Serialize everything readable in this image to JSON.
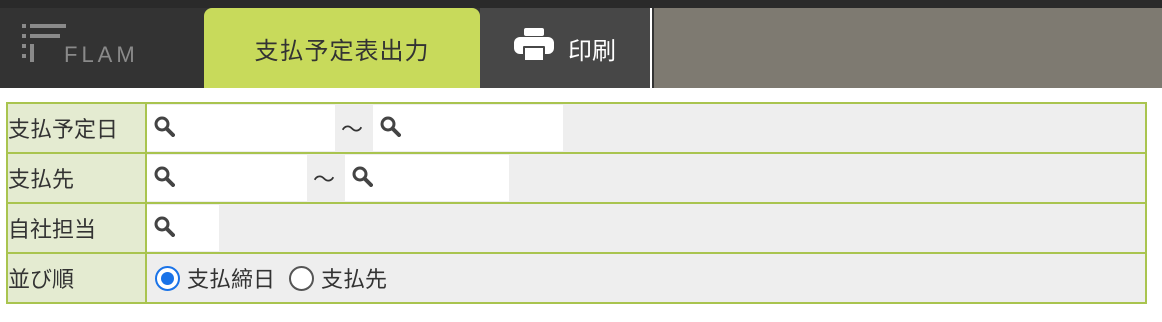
{
  "header": {
    "logo_text": "FLAM",
    "active_tab": "支払予定表出力",
    "print_label": "印刷"
  },
  "form": {
    "rows": [
      {
        "label": "支払予定日"
      },
      {
        "label": "支払先"
      },
      {
        "label": "自社担当"
      },
      {
        "label": "並び順"
      }
    ],
    "range_separator": "～",
    "sort_options": [
      {
        "label": "支払締日",
        "checked": true
      },
      {
        "label": "支払先",
        "checked": false
      }
    ]
  },
  "colors": {
    "accent": "#c8da5b",
    "border": "#a9c44f",
    "label_bg": "#e4ebd1",
    "radio": "#1a73e8"
  },
  "icons": [
    "search-icon",
    "printer-icon"
  ]
}
